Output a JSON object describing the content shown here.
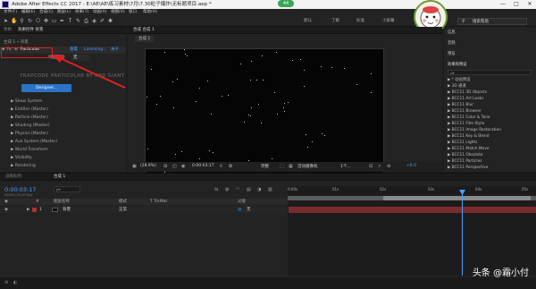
{
  "titlebar": {
    "title": "Adobe After Effects CC 2017 - E:\\AE\\AE\\练习素材\\7月\\7.30粒子爆炸\\无标题项目.aep *",
    "min": "—",
    "max": "□",
    "close": "✕",
    "badge": "44"
  },
  "menu": [
    "文件(F)",
    "编辑(E)",
    "合成(C)",
    "图层(L)",
    "效果(T)",
    "动画(A)",
    "视图(V)",
    "窗口",
    "帮助(H)"
  ],
  "workspaces": [
    "默认",
    "了解",
    "标准",
    "小屏幕"
  ],
  "search": {
    "placeholder": "搜索帮助"
  },
  "left_panel": {
    "tabs": [
      "项目",
      "效果控件 背景"
    ],
    "comp_label": "合成 1 • 背景",
    "effect_name": "Particular",
    "reset": "重置",
    "licensing": "Licensing...",
    "about": "关于",
    "animation_preset_label": "动画预设:",
    "animation_preset_value": "无",
    "plugin_title": "TRAPCODE PARTICULAR BY RED GIANT",
    "designer_button": "Designer...",
    "groups": [
      "Show System",
      "Emitter (Master)",
      "Particle (Master)",
      "Shading (Master)",
      "Physics (Master)",
      "Aux System (Master)",
      "World Transform",
      "Visibility",
      "Rendering"
    ]
  },
  "comp_panel": {
    "tab": "合成 合成 1",
    "subtab": "合成 1",
    "zoom": "(28.9%)",
    "timecode": "0:00:03:17",
    "quality": "完整",
    "camera": "活动摄像机",
    "views": "1个...",
    "exposure": "+0.0"
  },
  "right_panel": {
    "items": [
      "信息",
      "音频",
      "预览",
      "效果和预设"
    ],
    "search_placeholder": "ρ▾",
    "presets": [
      "* 动画预设",
      "3D 通道",
      "BCC11 3D Objects",
      "BCC11 Art Looks",
      "BCC11 Blur",
      "BCC11 Browser",
      "BCC11 Color & Tone",
      "BCC11 Film Style",
      "BCC11 Image Restoration",
      "BCC11 Key & Blend",
      "BCC11 Lights",
      "BCC11 Match Move",
      "BCC11 Obsolete",
      "BCC11 Particles",
      "BCC11 Perspective"
    ]
  },
  "timeline": {
    "tabs": [
      "渲染队列",
      "合成 1"
    ],
    "timecode": "0:00:03:17",
    "timecode_sub": "00092 (25.00 fps)",
    "search_placeholder": "ρ▾",
    "columns": [
      "#",
      "图层名称",
      "模式",
      "T TrkMat",
      "父级"
    ],
    "layer": {
      "index": "1",
      "name": "背景",
      "mode": "正常",
      "parent": "无"
    },
    "ruler": [
      "0:00s",
      "01s",
      "02s",
      "03s",
      "04s",
      "05s"
    ]
  },
  "watermark": "头条 @霜小付",
  "colors": {
    "accent": "#2a73c6",
    "highlight": "#e02020",
    "layer": "#7a2c2c"
  }
}
